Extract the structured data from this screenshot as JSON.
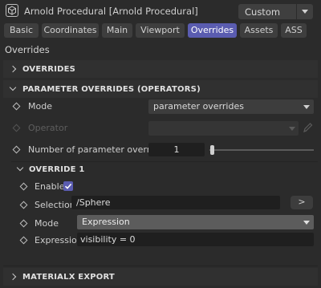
{
  "header": {
    "title": "Arnold Procedural [Arnold Procedural]",
    "preset_value": "Custom",
    "icon": "cube-icon"
  },
  "tabs": [
    {
      "label": "Basic",
      "active": false
    },
    {
      "label": "Coordinates",
      "active": false
    },
    {
      "label": "Main",
      "active": false
    },
    {
      "label": "Viewport",
      "active": false
    },
    {
      "label": "Overrides",
      "active": true
    },
    {
      "label": "Assets",
      "active": false
    },
    {
      "label": "ASS",
      "active": false
    }
  ],
  "page_title": "Overrides",
  "sections": {
    "overrides": {
      "title": "OVERRIDES",
      "expanded": false
    },
    "parameter_overrides": {
      "title": "PARAMETER OVERRIDES (OPERATORS)",
      "expanded": true
    },
    "override_1": {
      "title": "OVERRIDE 1",
      "expanded": true
    },
    "materialx_export": {
      "title": "MATERIALX EXPORT",
      "expanded": false
    }
  },
  "parameter_overrides": {
    "mode_label": "Mode",
    "mode_value": "parameter overrides",
    "operator_label": "Operator",
    "operator_value": "",
    "count_label": "Number of parameter overrides",
    "count_value": "1"
  },
  "override_1": {
    "enable_label": "Enable",
    "enable_checked": true,
    "selection_label": "Selection",
    "selection_value": "/Sphere",
    "selection_button": ">",
    "mode_label": "Mode",
    "mode_value": "Expression",
    "expression_label": "Expression",
    "expression_value": "visibility = 0"
  },
  "colors": {
    "accent": "#5a5cb0",
    "background": "#2b2b2b",
    "field": "#1f1f1f"
  }
}
